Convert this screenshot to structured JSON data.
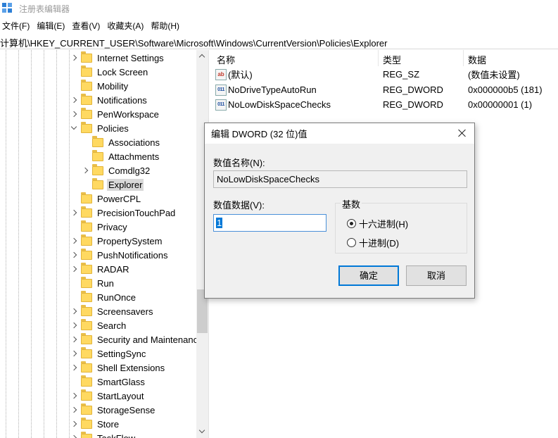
{
  "window": {
    "title": "注册表编辑器"
  },
  "menu": [
    "文件(F)",
    "编辑(E)",
    "查看(V)",
    "收藏夹(A)",
    "帮助(H)"
  ],
  "address": "计算机\\HKEY_CURRENT_USER\\Software\\Microsoft\\Windows\\CurrentVersion\\Policies\\Explorer",
  "tree": {
    "items": [
      {
        "label": "Internet Settings",
        "expander": "right",
        "level": 0
      },
      {
        "label": "Lock Screen",
        "expander": "none",
        "level": 0
      },
      {
        "label": "Mobility",
        "expander": "none",
        "level": 0
      },
      {
        "label": "Notifications",
        "expander": "right",
        "level": 0
      },
      {
        "label": "PenWorkspace",
        "expander": "right",
        "level": 0
      },
      {
        "label": "Policies",
        "expander": "down",
        "level": 0
      },
      {
        "label": "Associations",
        "expander": "none",
        "level": 1
      },
      {
        "label": "Attachments",
        "expander": "none",
        "level": 1
      },
      {
        "label": "Comdlg32",
        "expander": "right",
        "level": 1
      },
      {
        "label": "Explorer",
        "expander": "none",
        "level": 1,
        "selected": true
      },
      {
        "label": "PowerCPL",
        "expander": "none",
        "level": 0
      },
      {
        "label": "PrecisionTouchPad",
        "expander": "right",
        "level": 0
      },
      {
        "label": "Privacy",
        "expander": "none",
        "level": 0
      },
      {
        "label": "PropertySystem",
        "expander": "right",
        "level": 0
      },
      {
        "label": "PushNotifications",
        "expander": "right",
        "level": 0
      },
      {
        "label": "RADAR",
        "expander": "right",
        "level": 0
      },
      {
        "label": "Run",
        "expander": "none",
        "level": 0
      },
      {
        "label": "RunOnce",
        "expander": "none",
        "level": 0
      },
      {
        "label": "Screensavers",
        "expander": "right",
        "level": 0
      },
      {
        "label": "Search",
        "expander": "right",
        "level": 0
      },
      {
        "label": "Security and Maintenanc",
        "expander": "right",
        "level": 0
      },
      {
        "label": "SettingSync",
        "expander": "right",
        "level": 0
      },
      {
        "label": "Shell Extensions",
        "expander": "right",
        "level": 0
      },
      {
        "label": "SmartGlass",
        "expander": "none",
        "level": 0
      },
      {
        "label": "StartLayout",
        "expander": "right",
        "level": 0
      },
      {
        "label": "StorageSense",
        "expander": "right",
        "level": 0
      },
      {
        "label": "Store",
        "expander": "right",
        "level": 0
      },
      {
        "label": "TaskFlow",
        "expander": "right",
        "level": 0
      }
    ]
  },
  "list": {
    "headers": {
      "name": "名称",
      "type": "类型",
      "data": "数据"
    },
    "rows": [
      {
        "icon": "string-value-icon",
        "name": "(默认)",
        "type": "REG_SZ",
        "data": "(数值未设置)"
      },
      {
        "icon": "dword-value-icon",
        "name": "NoDriveTypeAutoRun",
        "type": "REG_DWORD",
        "data": "0x000000b5 (181)"
      },
      {
        "icon": "dword-value-icon",
        "name": "NoLowDiskSpaceChecks",
        "type": "REG_DWORD",
        "data": "0x00000001 (1)"
      }
    ]
  },
  "dialog": {
    "title": "编辑 DWORD (32 位)值",
    "name_label": "数值名称(N):",
    "name_value": "NoLowDiskSpaceChecks",
    "data_label": "数值数据(V):",
    "data_value": "1",
    "base_label": "基数",
    "hex_label": "十六进制(H)",
    "dec_label": "十进制(D)",
    "selected_base": "hex",
    "ok_label": "确定",
    "cancel_label": "取消"
  }
}
